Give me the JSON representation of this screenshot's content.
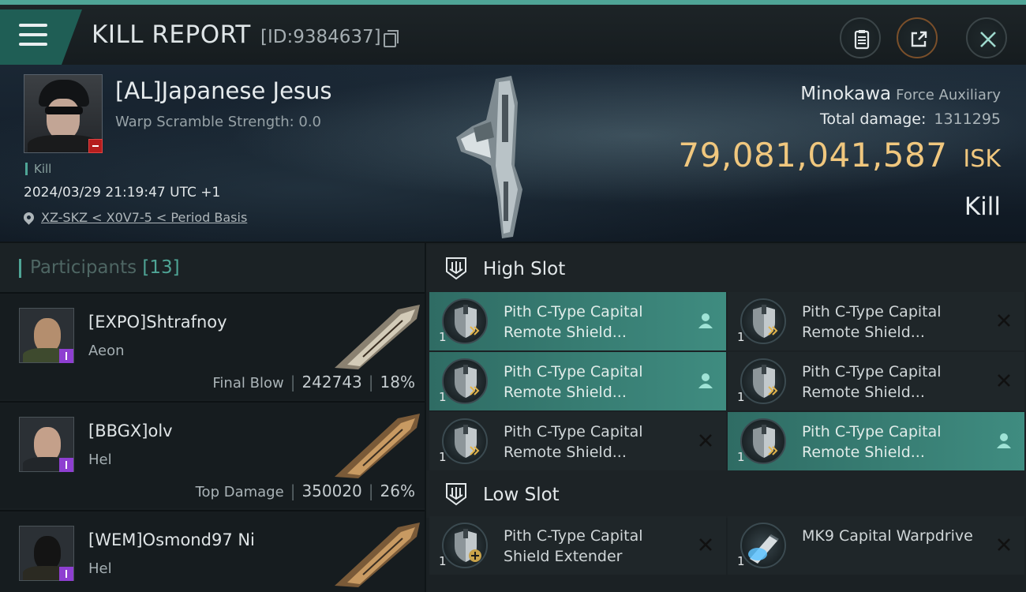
{
  "header": {
    "title": "KILL REPORT",
    "report_id": "[ID:9384637]"
  },
  "victim": {
    "name": "[AL]Japanese Jesus",
    "warp_scramble": "Warp Scramble Strength: 0.0",
    "status_small": "Kill",
    "datetime": "2024/03/29 21:19:47 UTC +1",
    "location": "XZ-SKZ < X0V7-5 < Period Basis",
    "ship_name": "Minokawa",
    "ship_class": "Force Auxiliary",
    "total_damage_label": "Total damage:",
    "total_damage_value": "1311295",
    "isk_value": "79,081,041,587",
    "isk_unit": "ISK",
    "status_big": "Kill"
  },
  "participants": {
    "title": "Participants",
    "count": "[13]",
    "items": [
      {
        "name": "[EXPO]Shtrafnoy",
        "ship": "Aeon",
        "role": "Final Blow",
        "damage": "242743",
        "percent": "18%",
        "face_color": "#b48e6e",
        "body_color": "#3e4a2e"
      },
      {
        "name": "[BBGX]olv",
        "ship": "Hel",
        "role": "Top Damage",
        "damage": "350020",
        "percent": "26%",
        "face_color": "#c4a08a",
        "body_color": "#22262a"
      },
      {
        "name": "[WEM]Osmond97 Ni",
        "ship": "Hel",
        "role": "",
        "damage": "",
        "percent": "",
        "face_color": "#141414",
        "body_color": "#2b2a22"
      }
    ]
  },
  "fitting": {
    "high_slot_title": "High Slot",
    "low_slot_title": "Low Slot",
    "high_slots": [
      {
        "qty": "1",
        "name": "Pith C-Type Capital Remote Shield...",
        "state": "active"
      },
      {
        "qty": "1",
        "name": "Pith C-Type Capital Remote Shield...",
        "state": "destroyed"
      },
      {
        "qty": "1",
        "name": "Pith C-Type Capital Remote Shield...",
        "state": "active"
      },
      {
        "qty": "1",
        "name": "Pith C-Type Capital Remote Shield...",
        "state": "destroyed"
      },
      {
        "qty": "1",
        "name": "Pith C-Type Capital Remote Shield...",
        "state": "destroyed"
      },
      {
        "qty": "1",
        "name": "Pith C-Type Capital Remote Shield...",
        "state": "active"
      }
    ],
    "low_slots": [
      {
        "qty": "1",
        "name": "Pith C-Type Capital Shield Extender",
        "state": "destroyed"
      },
      {
        "qty": "1",
        "name": "MK9 Capital Warpdrive",
        "state": "destroyed"
      }
    ]
  },
  "colors": {
    "accent": "#4fa596",
    "isk": "#f0c77e",
    "active_module": "#3f8c80",
    "badge_purple": "#8e3fd1",
    "badge_red": "#b51d1d"
  }
}
